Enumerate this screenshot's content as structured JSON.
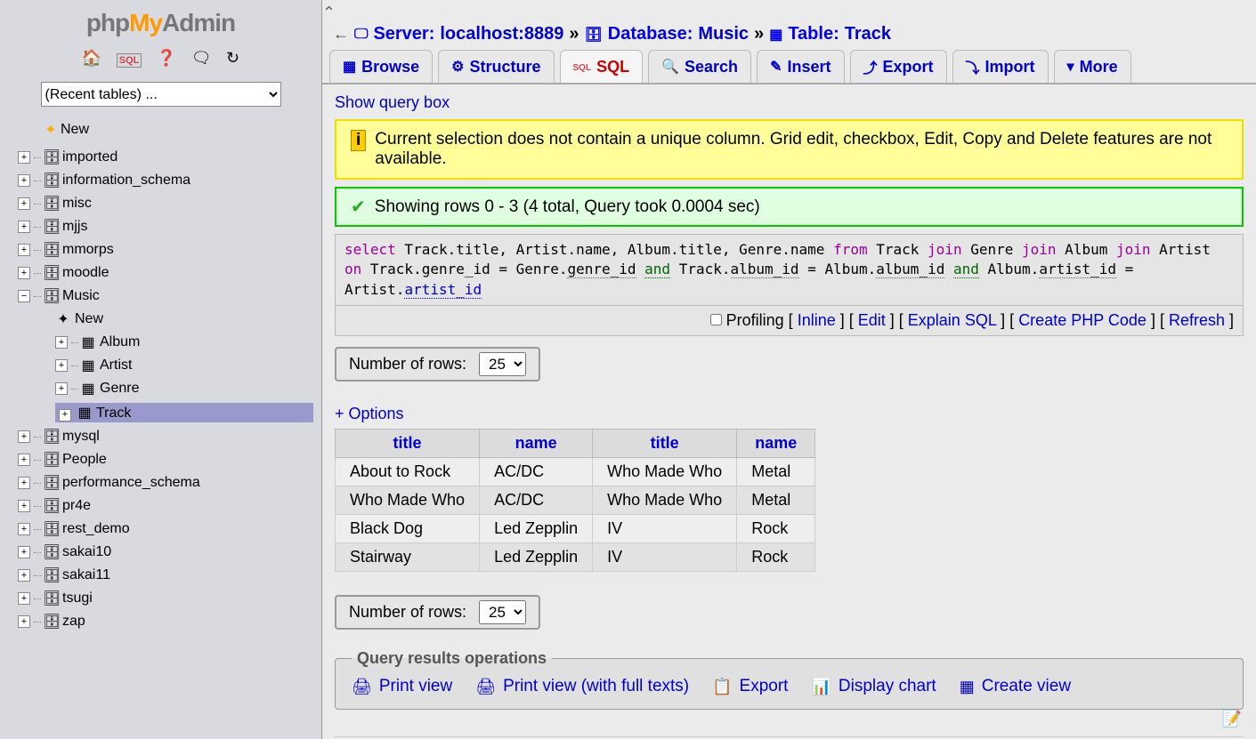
{
  "logo": {
    "php": "php",
    "my": "My",
    "admin": "Admin"
  },
  "recent_tables_placeholder": "(Recent tables) ...",
  "sidebar": {
    "new": "New",
    "databases": [
      {
        "label": "imported"
      },
      {
        "label": "information_schema"
      },
      {
        "label": "misc"
      },
      {
        "label": "mjjs"
      },
      {
        "label": "mmorps"
      },
      {
        "label": "moodle"
      },
      {
        "label": "Music",
        "expanded": true,
        "children": [
          {
            "label": "New",
            "new": true
          },
          {
            "label": "Album"
          },
          {
            "label": "Artist"
          },
          {
            "label": "Genre"
          },
          {
            "label": "Track",
            "selected": true
          }
        ]
      },
      {
        "label": "mysql"
      },
      {
        "label": "People"
      },
      {
        "label": "performance_schema"
      },
      {
        "label": "pr4e"
      },
      {
        "label": "rest_demo"
      },
      {
        "label": "sakai10"
      },
      {
        "label": "sakai11"
      },
      {
        "label": "tsugi"
      },
      {
        "label": "zap"
      }
    ]
  },
  "breadcrumb": {
    "server_label": "Server:",
    "server_value": "localhost:8889",
    "database_label": "Database:",
    "database_value": "Music",
    "table_label": "Table:",
    "table_value": "Track"
  },
  "tabs": [
    {
      "label": "Browse",
      "icon": "▦"
    },
    {
      "label": "Structure",
      "icon": "⚙"
    },
    {
      "label": "SQL",
      "icon": "sql",
      "active": true
    },
    {
      "label": "Search",
      "icon": "🔍"
    },
    {
      "label": "Insert",
      "icon": "✎"
    },
    {
      "label": "Export",
      "icon": "⤴"
    },
    {
      "label": "Import",
      "icon": "⤵"
    },
    {
      "label": "More",
      "icon": "▾"
    }
  ],
  "show_query": "Show query box",
  "warning_text": "Current selection does not contain a unique column. Grid edit, checkbox, Edit, Copy and Delete features are not available.",
  "success_text": "Showing rows 0 - 3 (4 total, Query took 0.0004 sec)",
  "sql_query": {
    "tokens": [
      {
        "t": "select",
        "k": true
      },
      {
        "t": " Track.title, Artist.name, Album.title, Genre.name "
      },
      {
        "t": "from",
        "k": true
      },
      {
        "t": " Track "
      },
      {
        "t": "join",
        "k": true
      },
      {
        "t": " Genre "
      },
      {
        "t": "join",
        "k": true
      },
      {
        "t": " Album "
      },
      {
        "t": "join",
        "k": true
      },
      {
        "t": " Artist "
      },
      {
        "t": "on",
        "k": true
      },
      {
        "t": " Track.genre_id = Genre."
      },
      {
        "t": "genre_id",
        "u": true
      },
      {
        "t": " "
      },
      {
        "t": "and",
        "o": true
      },
      {
        "t": " Track."
      },
      {
        "t": "album_id",
        "u": true
      },
      {
        "t": " = Album."
      },
      {
        "t": "album_id",
        "u": true
      },
      {
        "t": " "
      },
      {
        "t": "and",
        "o": true
      },
      {
        "t": " Album."
      },
      {
        "t": "artist_id",
        "u": true
      },
      {
        "t": " = Artist."
      },
      {
        "t": "artist_id",
        "l": true
      }
    ]
  },
  "sql_actions": {
    "profiling": "Profiling",
    "inline": "Inline",
    "edit": "Edit",
    "explain": "Explain SQL",
    "create_php": "Create PHP Code",
    "refresh": "Refresh"
  },
  "rows_label": "Number of rows:",
  "rows_value": "25",
  "options_link": "+ Options",
  "results": {
    "headers": [
      "title",
      "name",
      "title",
      "name"
    ],
    "rows": [
      [
        "About to Rock",
        "AC/DC",
        "Who Made Who",
        "Metal"
      ],
      [
        "Who Made Who",
        "AC/DC",
        "Who Made Who",
        "Metal"
      ],
      [
        "Black Dog",
        "Led Zepplin",
        "IV",
        "Rock"
      ],
      [
        "Stairway",
        "Led Zepplin",
        "IV",
        "Rock"
      ]
    ]
  },
  "ops": {
    "legend": "Query results operations",
    "print_view": "Print view",
    "print_full": "Print view (with full texts)",
    "export": "Export",
    "chart": "Display chart",
    "create_view": "Create view"
  }
}
